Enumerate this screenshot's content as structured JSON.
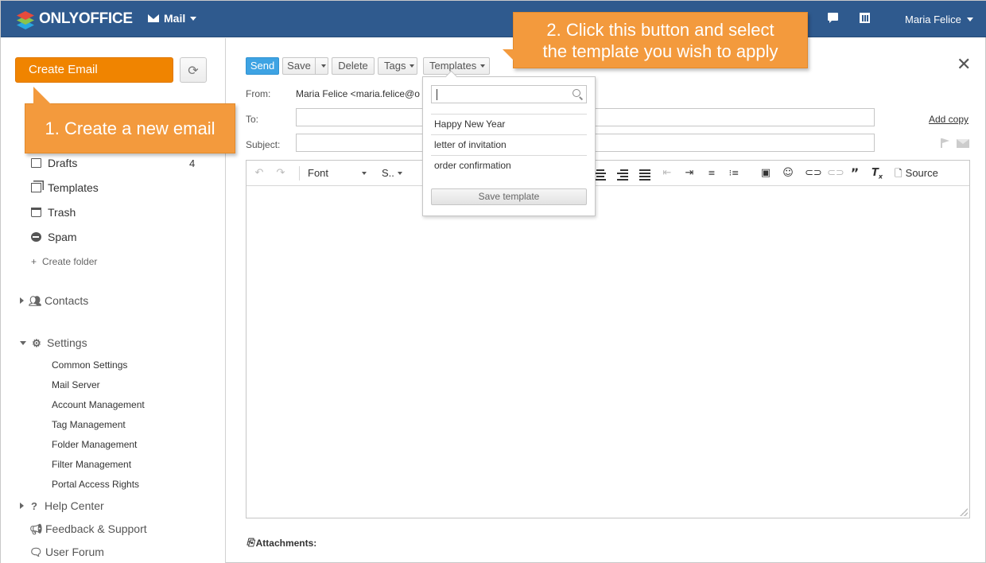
{
  "topbar": {
    "logo_text": "ONLYOFFICE",
    "module_label": "Mail",
    "user_name": "Maria Felice"
  },
  "sidebar": {
    "create_label": "Create Email",
    "folders": [
      {
        "label": "Drafts",
        "count": "4"
      },
      {
        "label": "Templates"
      },
      {
        "label": "Trash"
      },
      {
        "label": "Spam"
      }
    ],
    "create_folder": "Create folder",
    "contacts": "Contacts",
    "settings": "Settings",
    "settings_items": [
      "Common Settings",
      "Mail Server",
      "Account Management",
      "Tag Management",
      "Folder Management",
      "Filter Management",
      "Portal Access Rights"
    ],
    "help_center": "Help Center",
    "feedback": "Feedback & Support",
    "user_forum": "User Forum"
  },
  "callouts": {
    "step1": "1. Create a new email",
    "step2_line1": "2. Click this button and select",
    "step2_line2": "the template you wish to apply"
  },
  "compose": {
    "send": "Send",
    "save": "Save",
    "delete": "Delete",
    "tags": "Tags",
    "templates": "Templates",
    "from_label": "From:",
    "from_value": "Maria Felice <maria.felice@o",
    "to_label": "To:",
    "subject_label": "Subject:",
    "add_copy": "Add copy",
    "attachments": "Attachments:"
  },
  "editor": {
    "font": "Font",
    "size": "S..",
    "source": "Source"
  },
  "templates_dropdown": {
    "search_value": "",
    "items": [
      "Happy New Year",
      "letter of invitation",
      "order confirmation"
    ],
    "save_template": "Save template"
  },
  "colors": {
    "topbar": "#2f5a8e",
    "accent_orange": "#f08400",
    "callout": "#f39a3d",
    "send_blue": "#3ea3e3"
  }
}
